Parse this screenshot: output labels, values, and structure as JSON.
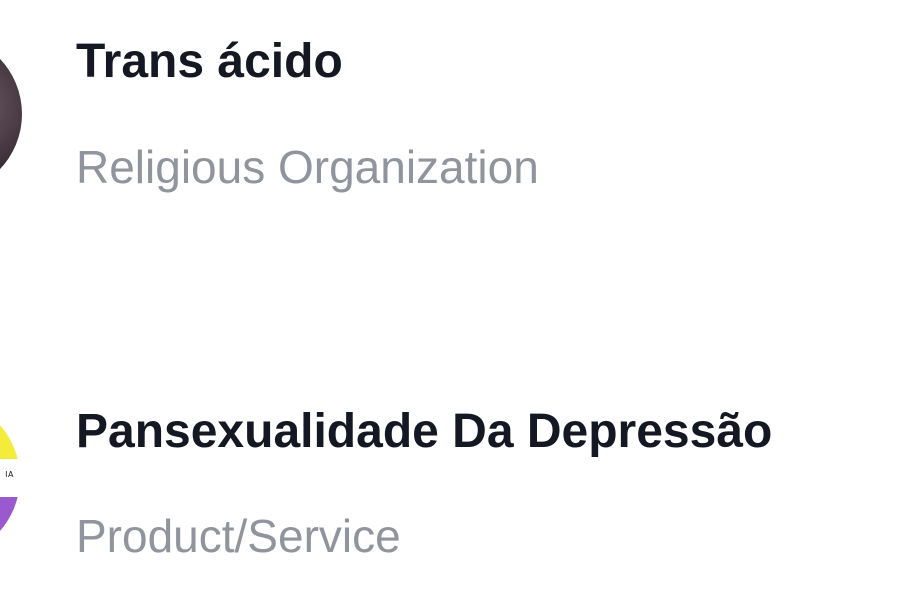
{
  "results": [
    {
      "name": "Trans ácido",
      "category": "Religious Organization",
      "avatar_icon": "profile-photo"
    },
    {
      "name": "Pansexualidade Da Depressão",
      "category": "Product/Service",
      "avatar_icon": "profile-photo",
      "avatar_colors": [
        "#f4ec3a",
        "#ffffff",
        "#9b59d0"
      ]
    }
  ],
  "colors": {
    "title": "#141823",
    "subtitle": "#90949c",
    "background": "#ffffff"
  }
}
